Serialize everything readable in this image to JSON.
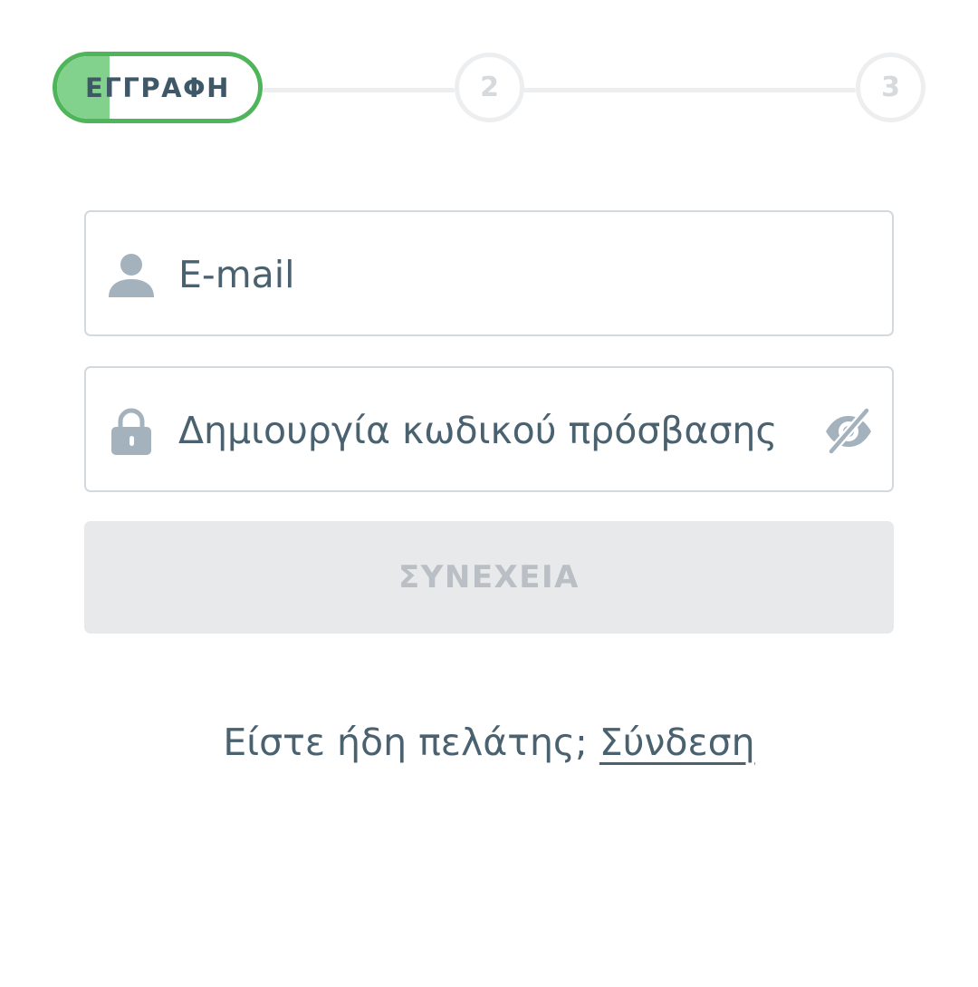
{
  "stepper": {
    "current_step_label": "ΕΓΓΡΑΦΗ",
    "current_step_progress": 0.26,
    "steps": [
      "2",
      "3"
    ],
    "colors": {
      "active_border": "#4fb55a",
      "active_fill": "#82d18c",
      "inactive": "#eceef0"
    }
  },
  "form": {
    "email": {
      "placeholder": "E-mail",
      "value": "",
      "icon": "user-icon"
    },
    "password": {
      "placeholder": "Δημιουργία κωδικού πρόσβασης",
      "value": "",
      "icon": "lock-icon",
      "toggle_icon": "eye-slash-icon"
    },
    "continue_label": "ΣΥΝΕΧΕΙΑ"
  },
  "footer": {
    "prompt": "Είστε ήδη πελάτης;",
    "login_link": "Σύνδεση"
  }
}
